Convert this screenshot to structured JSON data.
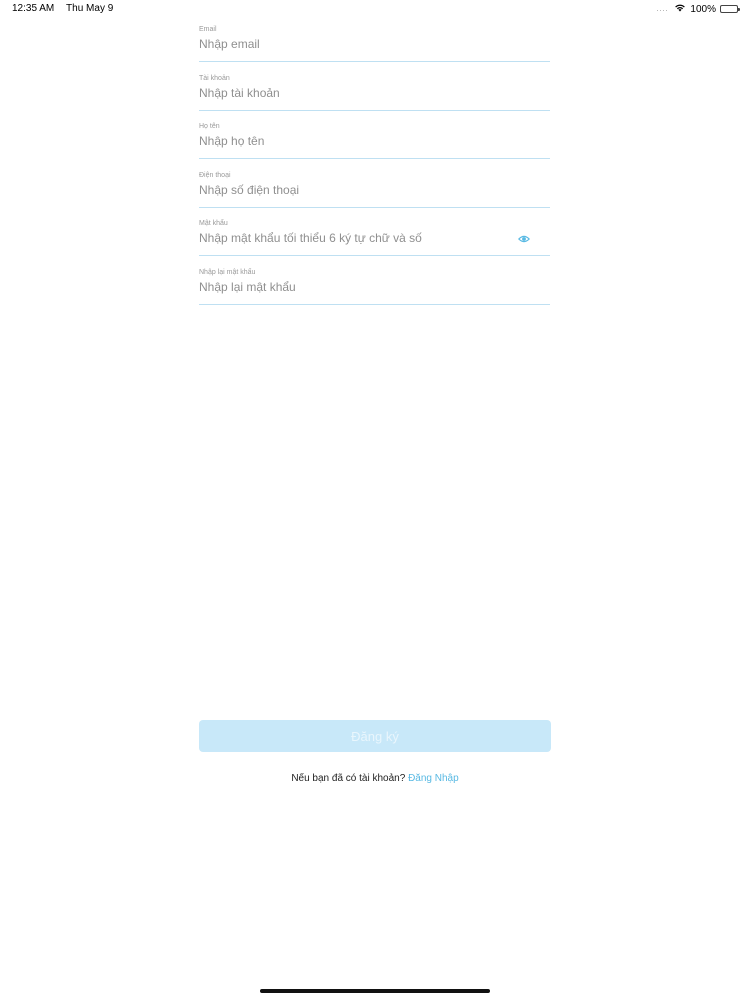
{
  "status_bar": {
    "time": "12:35 AM",
    "date": "Thu May 9",
    "signal_dots": "....",
    "battery_percent": "100%",
    "battery_level": 1.0
  },
  "form": {
    "fields": [
      {
        "label": "Email",
        "placeholder": "Nhập email",
        "value": ""
      },
      {
        "label": "Tài khoản",
        "placeholder": "Nhập tài khoản",
        "value": ""
      },
      {
        "label": "Họ tên",
        "placeholder": "Nhập họ tên",
        "value": ""
      },
      {
        "label": "Điện thoại",
        "placeholder": "Nhập số điện thoại",
        "value": ""
      },
      {
        "label": "Mật khẩu",
        "placeholder": "Nhập mật khẩu tối thiểu 6 ký tự chữ và số",
        "value": ""
      },
      {
        "label": "Nhập lại mật khẩu",
        "placeholder": "Nhập lại mật khẩu",
        "value": ""
      }
    ],
    "password_toggle_icon": "eye-icon"
  },
  "register_button": {
    "label": "Đăng ký",
    "enabled": false
  },
  "login_prompt": {
    "text": "Nếu bạn đã có tài khoản?",
    "link": "Đăng Nhập"
  },
  "colors": {
    "accent": "#58b9e3",
    "button_bg_disabled": "#c8e8f9",
    "divider": "#bfe0f2"
  }
}
